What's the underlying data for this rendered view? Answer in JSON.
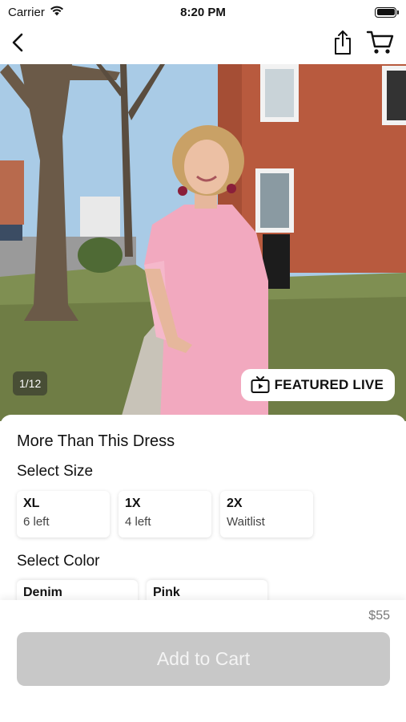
{
  "status_bar": {
    "carrier": "Carrier",
    "time": "8:20 PM"
  },
  "nav": {
    "back_icon": "chevron-left-icon",
    "share_icon": "share-icon",
    "cart_icon": "cart-icon"
  },
  "gallery": {
    "counter": "1/12",
    "badge_icon": "tv-play-icon",
    "badge_label": "FEATURED LIVE"
  },
  "product": {
    "title": "More Than This Dress",
    "size_section_label": "Select Size",
    "sizes": [
      {
        "name": "XL",
        "stock": "6 left"
      },
      {
        "name": "1X",
        "stock": "4 left"
      },
      {
        "name": "2X",
        "stock": "Waitlist"
      }
    ],
    "color_section_label": "Select Color",
    "colors": [
      {
        "name": "Denim"
      },
      {
        "name": "Pink"
      }
    ]
  },
  "footer": {
    "price": "$55",
    "add_to_cart_label": "Add to Cart",
    "button_color": "#c8c8c8"
  }
}
